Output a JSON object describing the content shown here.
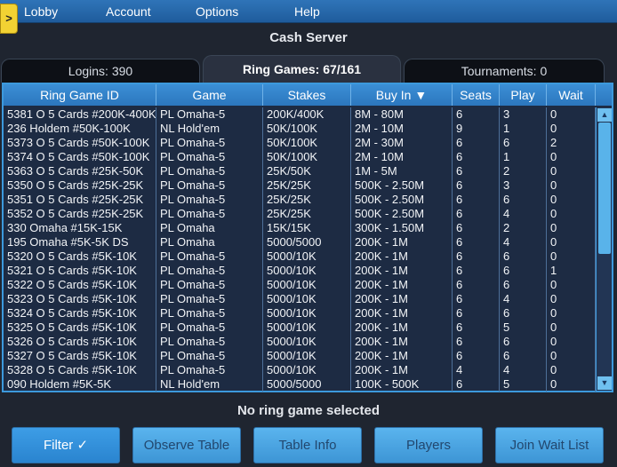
{
  "menu": [
    "Lobby",
    "Account",
    "Options",
    "Help"
  ],
  "corner_button": ">",
  "title": "Cash Server",
  "tabs": [
    {
      "label": "Logins: 390",
      "active": false
    },
    {
      "label": "Ring Games: 67/161",
      "active": true
    },
    {
      "label": "Tournaments: 0",
      "active": false
    }
  ],
  "table": {
    "columns": [
      "Ring Game ID",
      "Game",
      "Stakes",
      "Buy In ▼",
      "Seats",
      "Play",
      "Wait"
    ],
    "rows": [
      [
        "5381 O 5 Cards #200K-400K",
        "PL Omaha-5",
        "200K/400K",
        "8M - 80M",
        "6",
        "3",
        "0"
      ],
      [
        "236 Holdem #50K-100K",
        "NL Hold'em",
        "50K/100K",
        "2M - 10M",
        "9",
        "1",
        "0"
      ],
      [
        "5373 O 5 Cards #50K-100K",
        "PL Omaha-5",
        "50K/100K",
        "2M - 30M",
        "6",
        "6",
        "2"
      ],
      [
        "5374 O 5 Cards #50K-100K",
        "PL Omaha-5",
        "50K/100K",
        "2M - 10M",
        "6",
        "1",
        "0"
      ],
      [
        "5363 O 5 Cards #25K-50K",
        "PL Omaha-5",
        "25K/50K",
        "1M - 5M",
        "6",
        "2",
        "0"
      ],
      [
        "5350 O 5 Cards #25K-25K",
        "PL Omaha-5",
        "25K/25K",
        "500K - 2.50M",
        "6",
        "3",
        "0"
      ],
      [
        "5351 O 5 Cards #25K-25K",
        "PL Omaha-5",
        "25K/25K",
        "500K - 2.50M",
        "6",
        "6",
        "0"
      ],
      [
        "5352 O 5 Cards #25K-25K",
        "PL Omaha-5",
        "25K/25K",
        "500K - 2.50M",
        "6",
        "4",
        "0"
      ],
      [
        "330 Omaha #15K-15K",
        "PL Omaha",
        "15K/15K",
        "300K - 1.50M",
        "6",
        "2",
        "0"
      ],
      [
        "195 Omaha #5K-5K DS",
        "PL Omaha",
        "5000/5000",
        "200K - 1M",
        "6",
        "4",
        "0"
      ],
      [
        "5320 O 5 Cards #5K-10K",
        "PL Omaha-5",
        "5000/10K",
        "200K - 1M",
        "6",
        "6",
        "0"
      ],
      [
        "5321 O 5 Cards #5K-10K",
        "PL Omaha-5",
        "5000/10K",
        "200K - 1M",
        "6",
        "6",
        "1"
      ],
      [
        "5322 O 5 Cards #5K-10K",
        "PL Omaha-5",
        "5000/10K",
        "200K - 1M",
        "6",
        "6",
        "0"
      ],
      [
        "5323 O 5 Cards #5K-10K",
        "PL Omaha-5",
        "5000/10K",
        "200K - 1M",
        "6",
        "4",
        "0"
      ],
      [
        "5324 O 5 Cards #5K-10K",
        "PL Omaha-5",
        "5000/10K",
        "200K - 1M",
        "6",
        "6",
        "0"
      ],
      [
        "5325 O 5 Cards #5K-10K",
        "PL Omaha-5",
        "5000/10K",
        "200K - 1M",
        "6",
        "5",
        "0"
      ],
      [
        "5326 O 5 Cards #5K-10K",
        "PL Omaha-5",
        "5000/10K",
        "200K - 1M",
        "6",
        "6",
        "0"
      ],
      [
        "5327 O 5 Cards #5K-10K",
        "PL Omaha-5",
        "5000/10K",
        "200K - 1M",
        "6",
        "6",
        "0"
      ],
      [
        "5328 O 5 Cards #5K-10K",
        "PL Omaha-5",
        "5000/10K",
        "200K - 1M",
        "4",
        "4",
        "0"
      ],
      [
        "090 Holdem #5K-5K",
        "NL Hold'em",
        "5000/5000",
        "100K - 500K",
        "6",
        "5",
        "0"
      ]
    ]
  },
  "scroll_up_icon": "triangle-up-icon",
  "scroll_down_icon": "triangle-down-icon",
  "scroll_up_glyph": "▲",
  "scroll_down_glyph": "▼",
  "status": "No ring game selected",
  "buttons": [
    "Filter ✓",
    "Observe Table",
    "Table Info",
    "Players",
    "Join Wait List"
  ],
  "colors": {
    "menubar": "#2f74b8",
    "table_bg": "#1d2b43",
    "header_bg": "#3b8fd6",
    "button_bg": "#4ea8e6",
    "corner_button": "#f2d233"
  }
}
